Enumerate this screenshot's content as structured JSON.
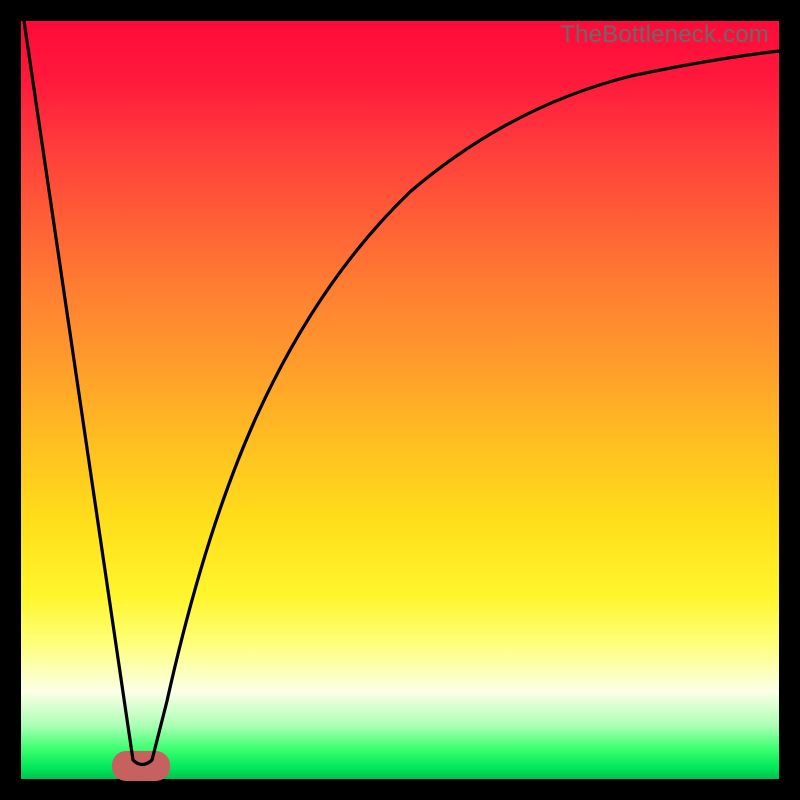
{
  "watermark": "TheBottleneck.com",
  "chart_data": {
    "type": "line",
    "title": "",
    "xlabel": "",
    "ylabel": "",
    "xlim": [
      0,
      100
    ],
    "ylim": [
      0,
      100
    ],
    "series": [
      {
        "name": "bottleneck-curve",
        "x": [
          0,
          5,
          10,
          13,
          15,
          17,
          19,
          21,
          25,
          30,
          35,
          40,
          45,
          50,
          55,
          60,
          65,
          70,
          75,
          80,
          85,
          90,
          95,
          100
        ],
        "y": [
          100,
          62,
          25,
          3,
          0,
          0,
          3,
          12,
          31,
          50,
          62,
          71,
          77.5,
          82,
          85.3,
          87.8,
          89.7,
          91.1,
          92.2,
          93.1,
          93.8,
          94.3,
          94.6,
          94.9
        ]
      }
    ],
    "marker": {
      "x_center": 16,
      "y": 0,
      "width_pct": 7
    },
    "gradient_stops": [
      {
        "pct": 0,
        "color": "#ff0a3a"
      },
      {
        "pct": 50,
        "color": "#ffc81f"
      },
      {
        "pct": 85,
        "color": "#fffc9b"
      },
      {
        "pct": 100,
        "color": "#00c24e"
      }
    ]
  }
}
